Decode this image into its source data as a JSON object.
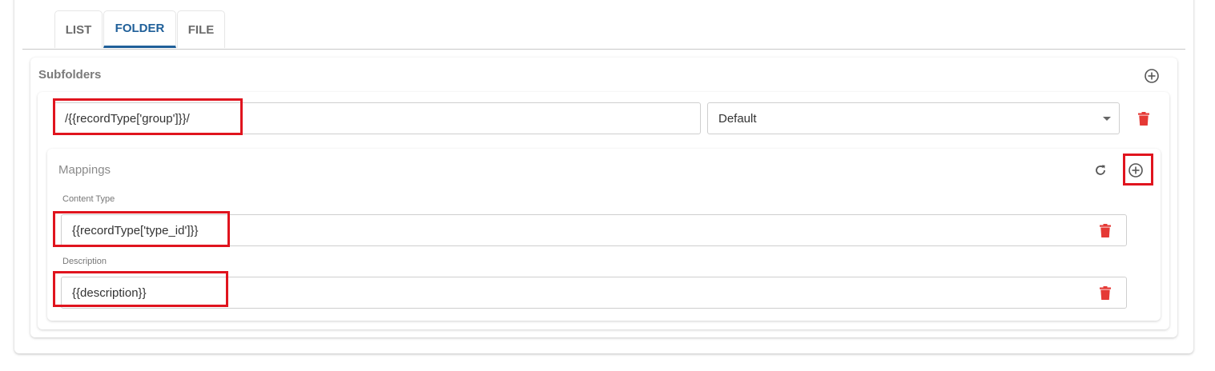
{
  "tabs": [
    {
      "label": "LIST",
      "active": false
    },
    {
      "label": "FOLDER",
      "active": true
    },
    {
      "label": "FILE",
      "active": false
    }
  ],
  "subfolders": {
    "title": "Subfolders",
    "add_icon": "add-circle-icon",
    "item": {
      "path_value": "/{{recordType['group']}}/",
      "select_value": "Default",
      "delete_icon": "trash-icon"
    }
  },
  "mappings": {
    "title": "Mappings",
    "refresh_icon": "refresh-icon",
    "add_icon": "add-circle-icon",
    "fields": [
      {
        "label": "Content Type",
        "value": "{{recordType['type_id']}}"
      },
      {
        "label": "Description",
        "value": "{{description}}"
      }
    ]
  },
  "colors": {
    "accent": "#1f5f99",
    "delete": "#e53935",
    "highlight": "#e0141e"
  }
}
